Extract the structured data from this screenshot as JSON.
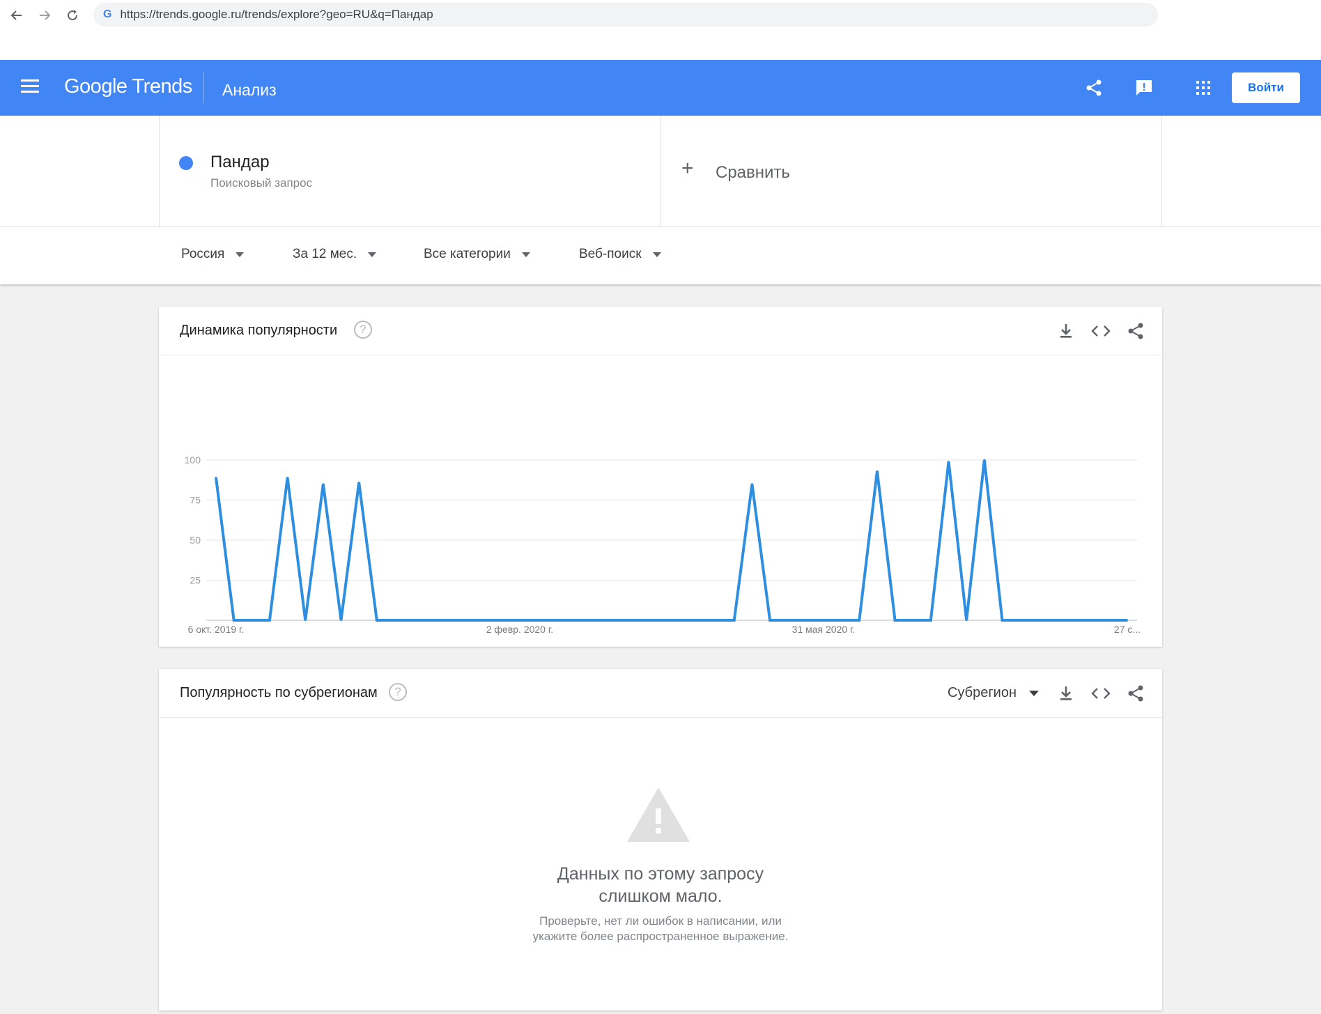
{
  "browser": {
    "url": "https://trends.google.ru/trends/explore?geo=RU&q=Пандар",
    "back_icon": "arrow-left-icon",
    "forward_icon": "arrow-right-icon",
    "reload_icon": "reload-icon"
  },
  "header": {
    "logo": "Google Trends",
    "title": "Анализ",
    "signin_label": "Войти",
    "accent_color": "#4285f4"
  },
  "term": {
    "name": "Пандар",
    "type": "Поисковый запрос",
    "color": "#4285f4"
  },
  "compare": {
    "plus": "+",
    "label": "Сравнить"
  },
  "filters": {
    "region": "Россия",
    "period": "За 12 мес.",
    "category": "Все категории",
    "search_type": "Веб-поиск"
  },
  "interest_card": {
    "title": "Динамика популярности",
    "help": "?"
  },
  "subregion_card": {
    "title": "Популярность по субрегионам",
    "help": "?",
    "select_label": "Субрегион",
    "empty_title_line1": "Данных по этому запросу",
    "empty_title_line2": "слишком мало.",
    "empty_sub_line1": "Проверьте, нет ли ошибок в написании, или",
    "empty_sub_line2": "укажите более распространенное выражение."
  },
  "chart_data": {
    "type": "line",
    "title": "",
    "xlabel": "",
    "ylabel": "",
    "ylim": [
      0,
      100
    ],
    "y_ticks": [
      "25",
      "50",
      "75",
      "100"
    ],
    "x_tick_labels": [
      "6 окт. 2019 г.",
      "2 февр. 2020 г.",
      "31 мая 2020 г.",
      "27 с..."
    ],
    "x_tick_weeks": [
      0,
      17,
      34,
      51
    ],
    "grid": true,
    "series": [
      {
        "color": "#2e8fe0",
        "values": [
          89,
          0,
          0,
          0,
          89,
          0,
          85,
          0,
          86,
          0,
          0,
          0,
          0,
          0,
          0,
          0,
          0,
          0,
          0,
          0,
          0,
          0,
          0,
          0,
          0,
          0,
          0,
          0,
          0,
          0,
          85,
          0,
          0,
          0,
          0,
          0,
          0,
          93,
          0,
          0,
          0,
          99,
          0,
          100,
          0,
          0,
          0,
          0,
          0,
          0,
          0,
          0
        ]
      }
    ]
  }
}
